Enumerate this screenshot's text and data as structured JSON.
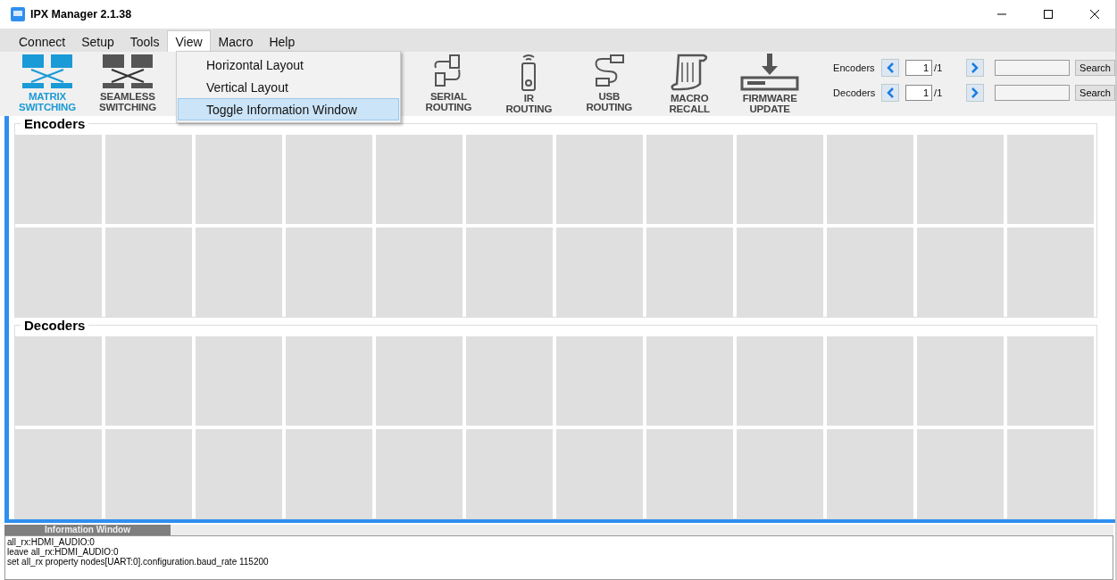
{
  "window": {
    "title": "IPX Manager 2.1.38"
  },
  "menu": [
    {
      "label": "Connect",
      "selected": false
    },
    {
      "label": "Setup",
      "selected": false
    },
    {
      "label": "Tools",
      "selected": false
    },
    {
      "label": "View",
      "selected": true
    },
    {
      "label": "Macro",
      "selected": false
    },
    {
      "label": "Help",
      "selected": false
    }
  ],
  "dropdown": [
    {
      "label": "Horizontal Layout",
      "selected": false
    },
    {
      "label": "Vertical Layout",
      "selected": false
    },
    {
      "label": "Toggle Information Window",
      "selected": true
    }
  ],
  "toolbar": [
    {
      "kind": "matrix",
      "label": "MATRIX\nSWITCHING",
      "selected": true
    },
    {
      "kind": "seamless",
      "label": "SEAMLESS\nSWITCHING",
      "selected": false
    },
    {
      "kind": "serial",
      "label": "SERIAL\nROUTING",
      "selected": false
    },
    {
      "kind": "ir",
      "label": "IR\nROUTING",
      "selected": false
    },
    {
      "kind": "usb",
      "label": "USB\nROUTING",
      "selected": false
    },
    {
      "kind": "macro",
      "label": "MACRO\nRECALL",
      "selected": false
    },
    {
      "kind": "firmware",
      "label": "FIRMWARE\nUPDATE",
      "selected": false
    }
  ],
  "pagers": [
    {
      "label": "Encoders",
      "page": "1",
      "total": "/1",
      "button": "Search"
    },
    {
      "label": "Decoders",
      "page": "1",
      "total": "/1",
      "button": "Search"
    }
  ],
  "groups": [
    {
      "title": "Encoders"
    },
    {
      "title": "Decoders"
    }
  ],
  "info_window": {
    "title": "Information Window",
    "lines": [
      "all_rx:HDMI_AUDIO:0",
      "leave all_rx:HDMI_AUDIO:0",
      "set all_rx property nodes[UART:0].configuration.baud_rate 115200"
    ]
  }
}
